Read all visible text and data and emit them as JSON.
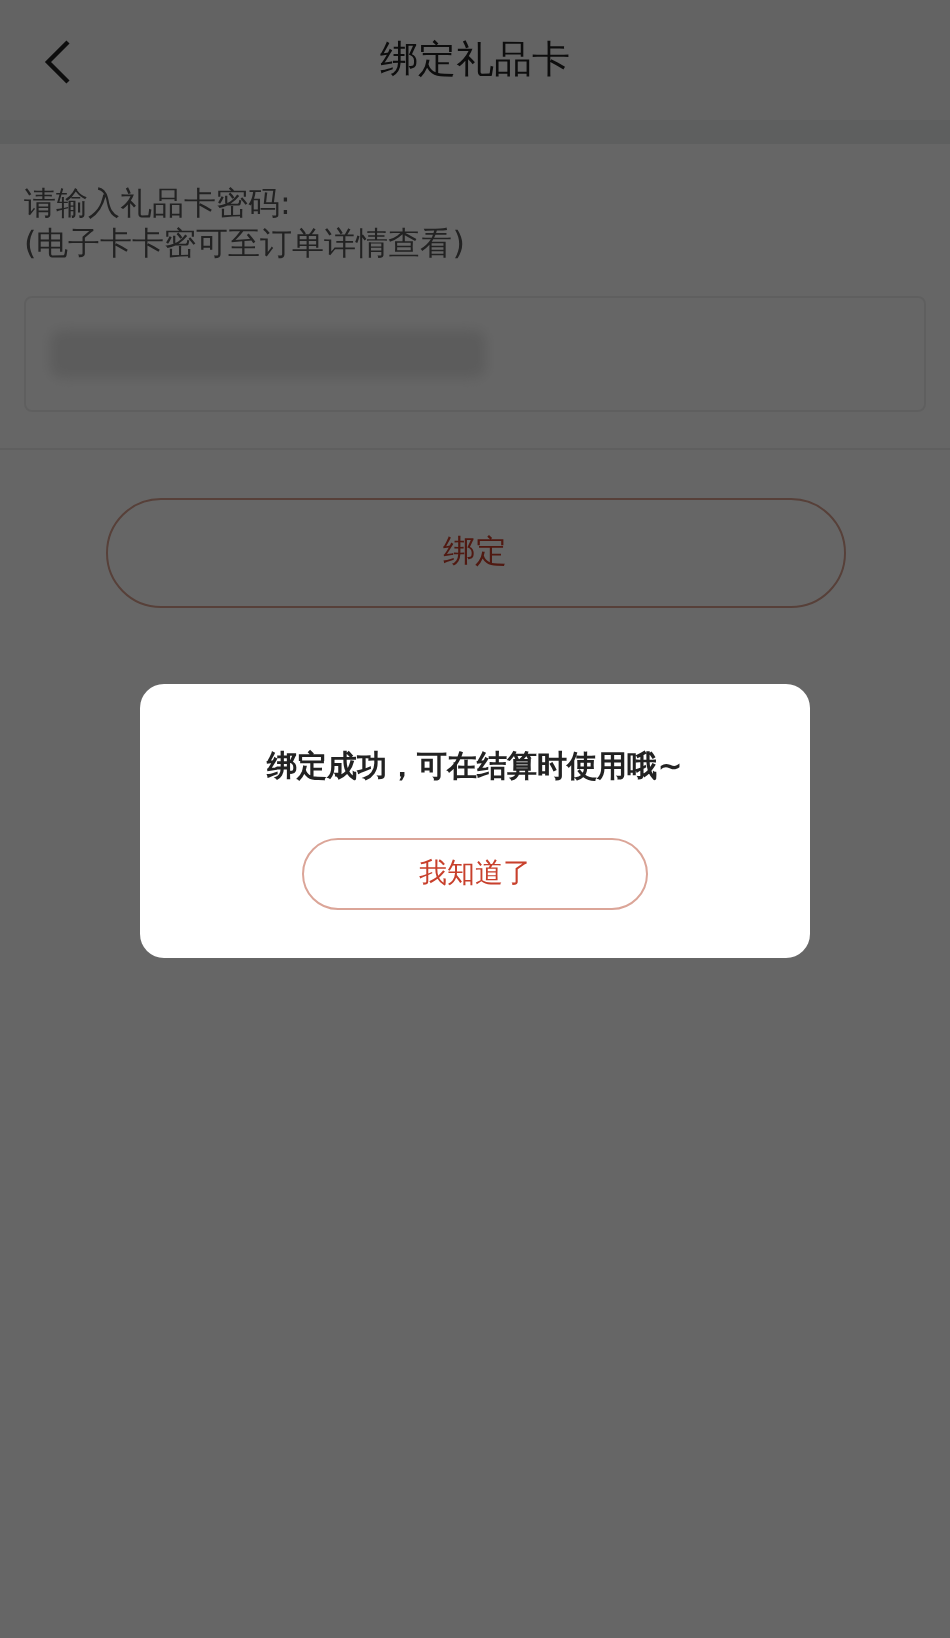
{
  "header": {
    "title": "绑定礼品卡"
  },
  "form": {
    "label": "请输入礼品卡密码:",
    "hint": "(电子卡卡密可至订单详情查看)",
    "field": {
      "masked": true
    }
  },
  "bind_button": {
    "label": "绑定"
  },
  "dialog": {
    "message": "绑定成功，可在结算时使用哦~",
    "button": "我知道了"
  }
}
